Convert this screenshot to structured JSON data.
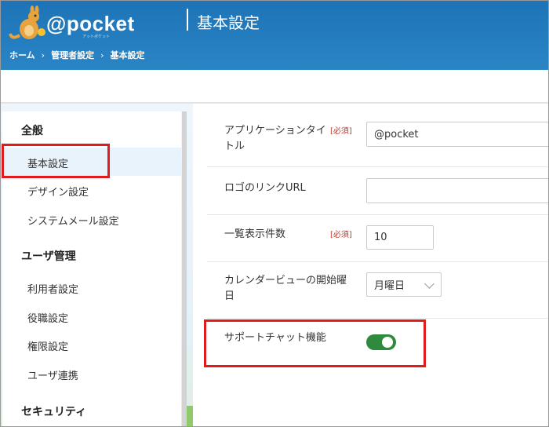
{
  "header": {
    "logo_text": "@pocket",
    "logo_sub": "アットポケット",
    "title": "基本設定",
    "breadcrumb": [
      "ホーム",
      "管理者設定",
      "基本設定"
    ],
    "breadcrumb_sep": "›"
  },
  "sidebar": {
    "sections": [
      {
        "label": "全般",
        "items": [
          "基本設定",
          "デザイン設定",
          "システムメール設定"
        ]
      },
      {
        "label": "ユーザ管理",
        "items": [
          "利用者設定",
          "役職設定",
          "権限設定",
          "ユーザ連携"
        ]
      },
      {
        "label": "セキュリティ",
        "items": []
      }
    ],
    "active_item": "基本設定"
  },
  "form": {
    "required_label": "[必須]",
    "app_title": {
      "label_line1": "アプリケーションタイ",
      "label_line2": "トル",
      "value": "@pocket"
    },
    "logo_link": {
      "label": "ロゴのリンクURL",
      "value": ""
    },
    "list_count": {
      "label": "一覧表示件数",
      "value": "10"
    },
    "calendar_start": {
      "label_line1": "カレンダービューの開始曜",
      "label_line2": "日",
      "value": "月曜日"
    },
    "support_chat": {
      "label": "サポートチャット機能",
      "enabled": true
    }
  },
  "colors": {
    "header_blue": "#1d73b6",
    "required_red": "#c0392b",
    "toggle_green": "#2e8b3d",
    "highlight_red": "#e01b1b"
  }
}
